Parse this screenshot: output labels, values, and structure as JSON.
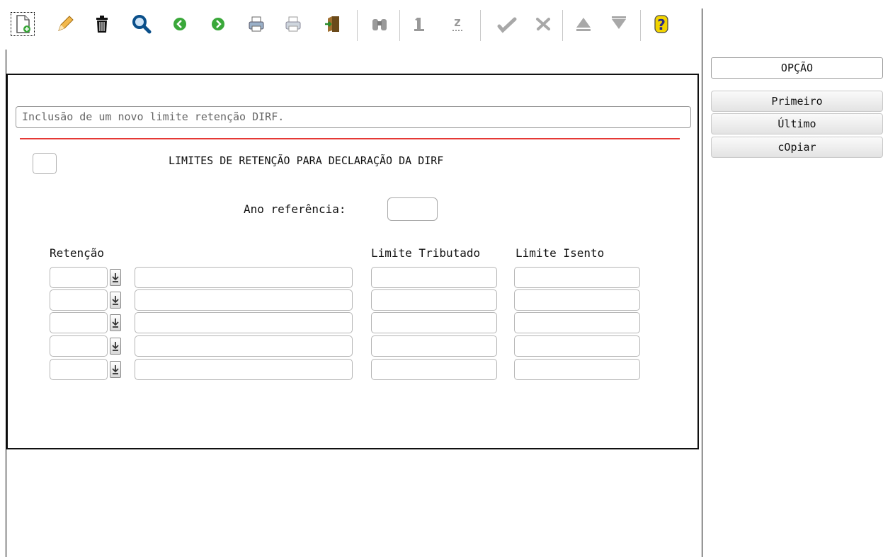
{
  "description": "Inclusão de um novo limite retenção DIRF.",
  "form": {
    "title": "LIMITES DE RETENÇÃO PARA DECLARAÇÃO DA DIRF",
    "ano_label": "Ano referência:",
    "ano_value": ""
  },
  "table": {
    "headers": [
      "Retenção",
      "Limite Tributado",
      "Limite Isento"
    ],
    "rows": [
      {
        "retencao": "",
        "descricao": "",
        "limite_tributado": "",
        "limite_isento": ""
      },
      {
        "retencao": "",
        "descricao": "",
        "limite_tributado": "",
        "limite_isento": ""
      },
      {
        "retencao": "",
        "descricao": "",
        "limite_tributado": "",
        "limite_isento": ""
      },
      {
        "retencao": "",
        "descricao": "",
        "limite_tributado": "",
        "limite_isento": ""
      },
      {
        "retencao": "",
        "descricao": "",
        "limite_tributado": "",
        "limite_isento": ""
      }
    ]
  },
  "side_panel": {
    "header": "OPÇÃO",
    "buttons": [
      "Primeiro",
      "Último",
      "cOpiar"
    ]
  },
  "toolbar": {
    "icons": [
      "new-record-icon",
      "edit-icon",
      "delete-icon",
      "search-icon",
      "previous-icon",
      "next-icon",
      "print-icon",
      "print-preview-icon",
      "exit-icon",
      "binoculars-icon",
      "first-icon",
      "last-icon",
      "confirm-icon",
      "cancel-icon",
      "up-icon",
      "down-icon",
      "help-icon"
    ]
  },
  "colors": {
    "accent_red": "#e53935",
    "help_yellow": "#f2d400",
    "green": "#3aa83a"
  }
}
